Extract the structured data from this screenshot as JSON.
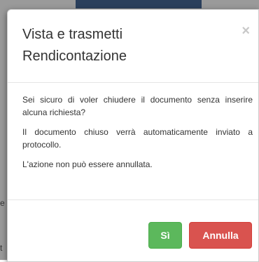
{
  "background": {
    "letters": [
      "e",
      "t"
    ]
  },
  "dialog": {
    "title": "Vista e trasmetti Rendicontazione",
    "close_glyph": "×",
    "body": {
      "paragraph1": "Sei sicuro di voler chiudere il documento senza inserire alcuna richiesta?",
      "paragraph2": "Il documento chiuso verrà automaticamente inviato a protocollo.",
      "paragraph3": "L'azione non può essere annullata."
    },
    "buttons": {
      "yes_label": "Sì",
      "cancel_label": "Annulla"
    }
  },
  "colors": {
    "yes_button": "#5cb85c",
    "cancel_button": "#d9534f",
    "backdrop": "#9a9a9a"
  }
}
